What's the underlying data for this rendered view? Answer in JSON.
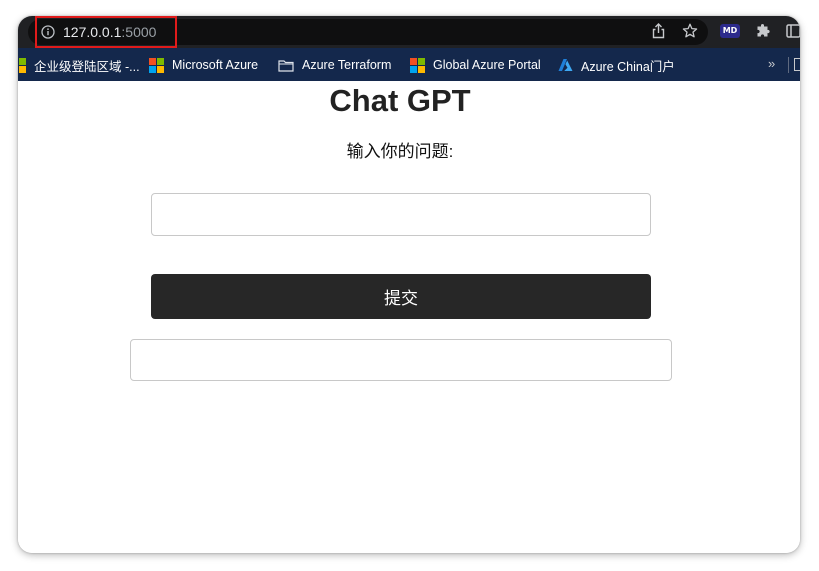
{
  "address_bar": {
    "host": "127.0.0.1",
    "port": ":5000"
  },
  "toolbar": {
    "extension_badge": "MD"
  },
  "bookmarks": [
    {
      "label": "企业级登陆区域 -...",
      "icon": "ms-logo-icon"
    },
    {
      "label": "Microsoft Azure",
      "icon": "ms-logo-icon"
    },
    {
      "label": "Azure Terraform",
      "icon": "folder-icon"
    },
    {
      "label": "Global Azure Portal",
      "icon": "ms-logo-icon"
    },
    {
      "label": "Azure China门户",
      "icon": "azure-icon"
    }
  ],
  "bookmarks_overflow": "»",
  "page": {
    "title": "Chat GPT",
    "question_label": "输入你的问题:",
    "question_value": "",
    "submit_label": "提交",
    "answer": ""
  },
  "colors": {
    "topbar": "#202124",
    "bookmarks_bar": "#14284c",
    "highlight": "#e01b1b",
    "button": "#272727",
    "ms_red": "#f25022",
    "ms_green": "#7fba00",
    "ms_blue": "#00a4ef",
    "ms_yellow": "#ffb900",
    "azure_blue": "#0078d4"
  }
}
